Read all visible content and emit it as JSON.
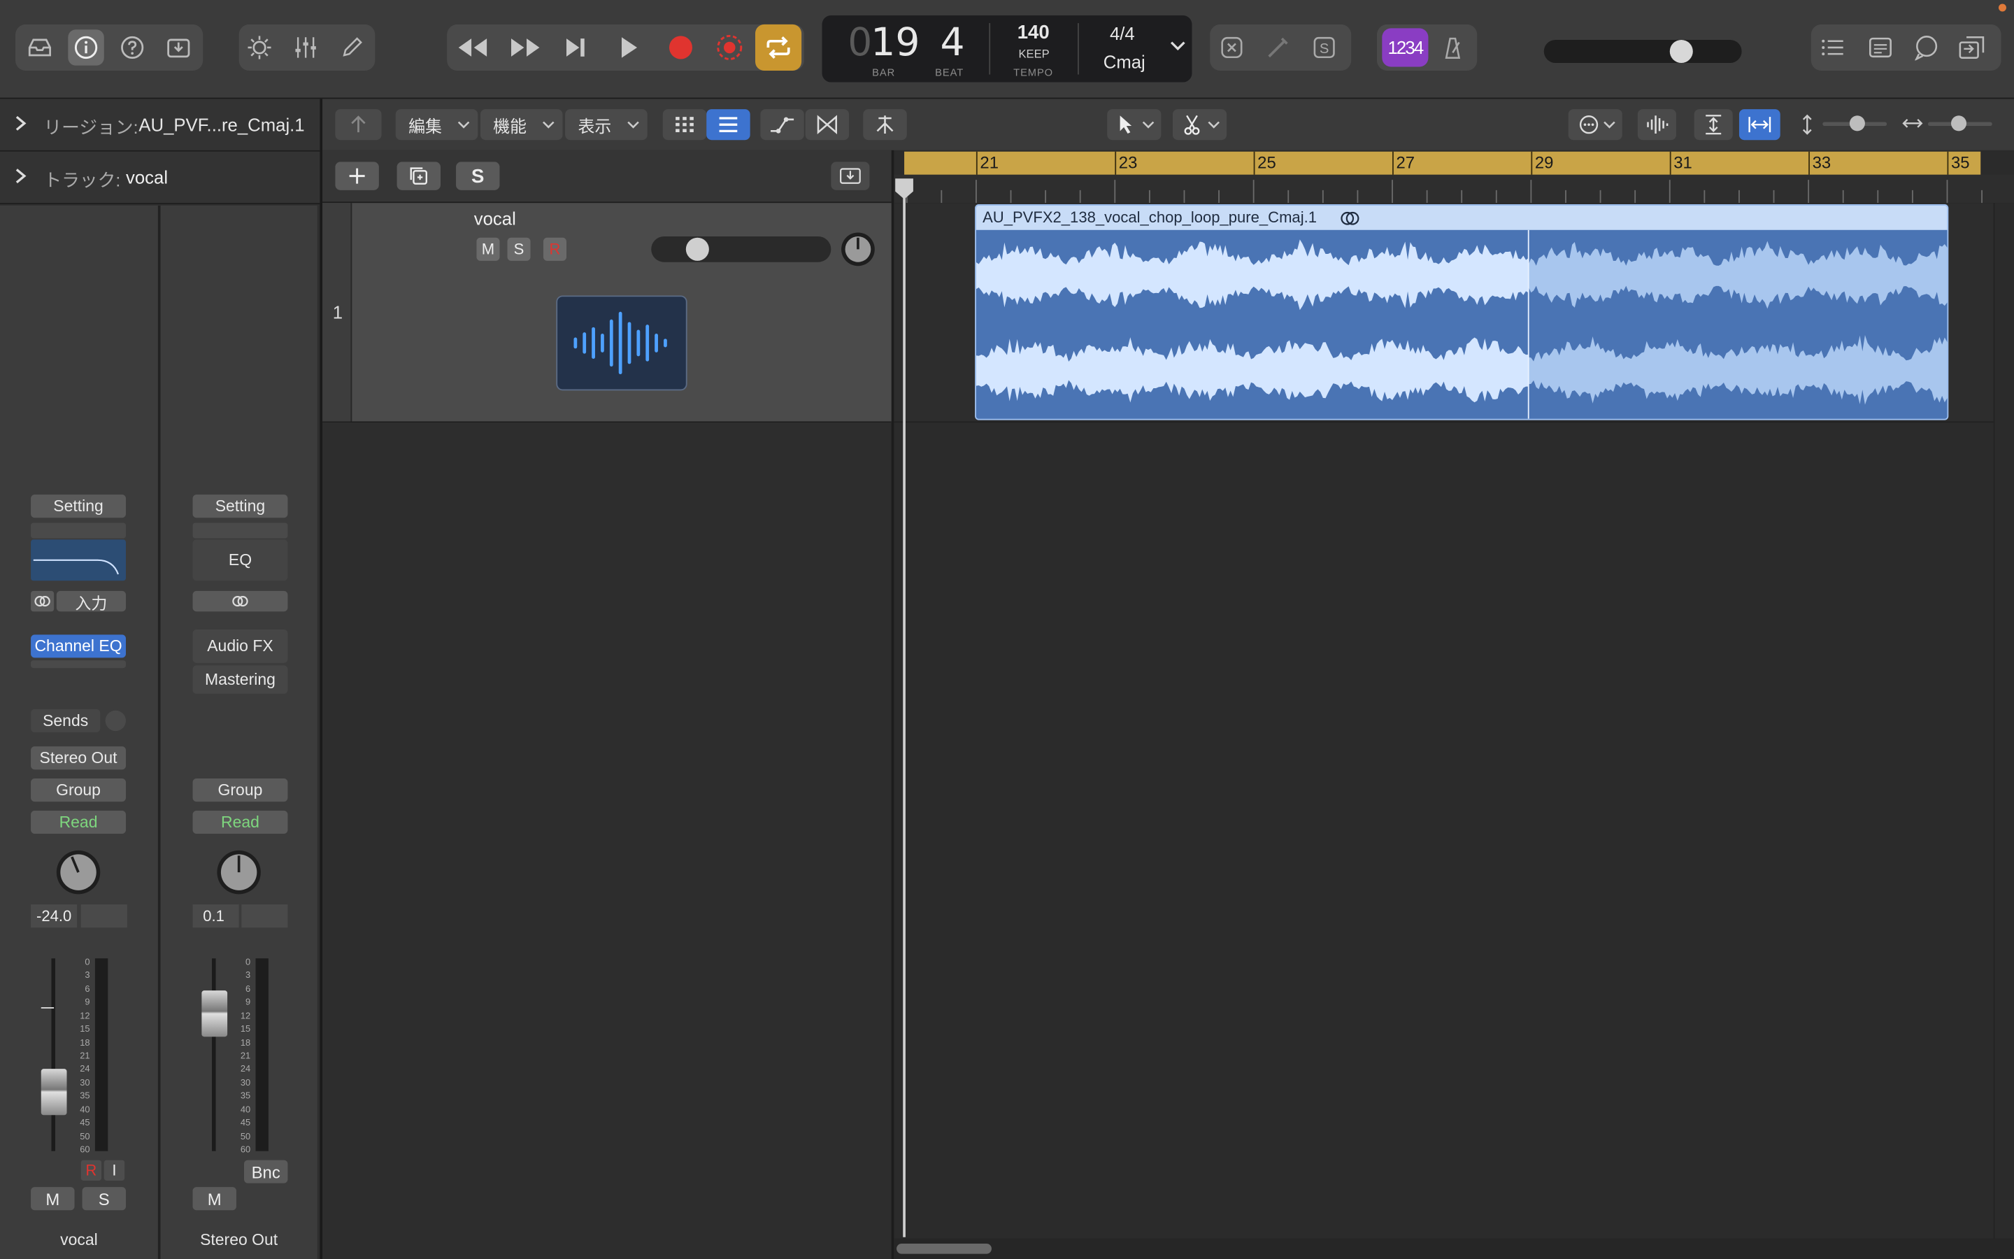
{
  "toolbar": {
    "position_bar_dim": "0",
    "position_bar": "19",
    "position_beat": "4",
    "bar_label": "BAR",
    "beat_label": "BEAT",
    "tempo": "140",
    "tempo_mode": "KEEP",
    "tempo_label": "TEMPO",
    "signature": "4/4",
    "key": "Cmaj",
    "count_in": "1234",
    "master_volume_level": 0.72
  },
  "inspector": {
    "region_label": "リージョン:",
    "region_name": "AU_PVF...re_Cmaj.1",
    "track_label": "トラック:",
    "track_name": "vocal",
    "strip1": {
      "setting": "Setting",
      "input": "入力",
      "plugin": "Channel EQ",
      "sends": "Sends",
      "output": "Stereo Out",
      "group": "Group",
      "automation": "Read",
      "pan_value": "-24.0",
      "rec": "R",
      "input_mon": "I",
      "mute": "M",
      "solo": "S",
      "name": "vocal",
      "fader_level": 0.25
    },
    "strip2": {
      "setting": "Setting",
      "eq": "EQ",
      "audio_fx": "Audio FX",
      "mastering": "Mastering",
      "group": "Group",
      "automation": "Read",
      "pan_value": "0.1",
      "bounce": "Bnc",
      "mute": "M",
      "name": "Stereo Out",
      "fader_level": 0.78
    },
    "meter_scale": [
      "0",
      "3",
      "6",
      "9",
      "12",
      "15",
      "18",
      "21",
      "24",
      "30",
      "35",
      "40",
      "45",
      "50",
      "60"
    ]
  },
  "tracks_toolbar": {
    "edit_menu": "編集",
    "function_menu": "機能",
    "view_menu": "表示"
  },
  "track_list_toolbar": {
    "solo_label": "S"
  },
  "track": {
    "number": "1",
    "name": "vocal",
    "mute": "M",
    "solo": "S",
    "record": "R",
    "volume_level": 0.22
  },
  "ruler": {
    "bars": [
      "21",
      "23",
      "25",
      "27",
      "29",
      "31",
      "33",
      "35"
    ]
  },
  "region": {
    "name": "AU_PVFX2_138_vocal_chop_loop_pure_Cmaj.1"
  },
  "colors": {
    "region_blue": "#4a74b4",
    "region_header": "#c8dcf7",
    "waveform": "#d4e6ff",
    "ruler_gold": "#c9a447",
    "record_red": "#e0342f",
    "cycle_gold": "#c9962f",
    "selected_blue": "#3d73cf",
    "count_in_purple": "#8a3dc3",
    "automation_green": "#7ed67e"
  }
}
